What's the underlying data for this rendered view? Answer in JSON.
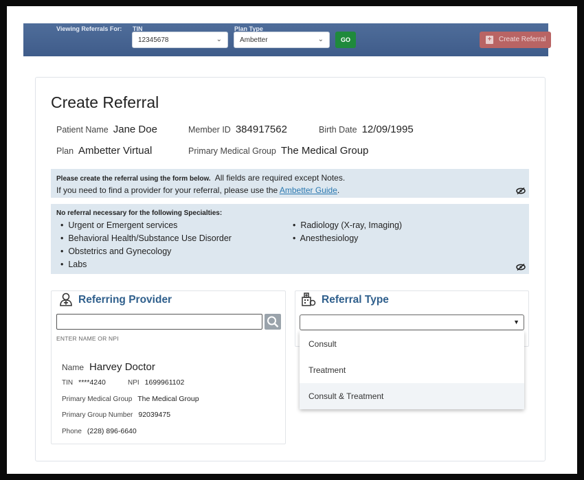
{
  "topbar": {
    "viewing_label": "Viewing Referrals For:",
    "tin_label": "TIN",
    "tin_value": "12345678",
    "plan_type_label": "Plan Type",
    "plan_type_value": "Ambetter",
    "go_label": "GO",
    "create_label": "Create Referral"
  },
  "page": {
    "title": "Create Referral"
  },
  "patient": {
    "name_label": "Patient Name",
    "name_value": "Jane Doe",
    "member_label": "Member ID",
    "member_value": "384917562",
    "birth_label": "Birth Date",
    "birth_value": "12/09/1995",
    "plan_label": "Plan",
    "plan_value": "Ambetter Virtual",
    "pmg_label": "Primary Medical Group",
    "pmg_value": "The Medical Group"
  },
  "info1": {
    "line1_bold": "Please create the referral using the form below.",
    "line1_rest": "All fields are required except Notes.",
    "line2_pre": "If you need to find a provider for your referral, please use the",
    "link": "Ambetter Guide",
    "line2_post": "."
  },
  "info2": {
    "heading": "No referral necessary for the following Specialties:",
    "left": [
      "Urgent or Emergent services",
      "Behavioral Health/Substance Use Disorder",
      "Obstetrics and Gynecology",
      "Labs"
    ],
    "right": [
      "Radiology (X-ray, Imaging)",
      "Anesthesiology"
    ]
  },
  "referring": {
    "title": "Referring Provider",
    "search_value": "",
    "hint": "ENTER NAME OR NPI",
    "name_label": "Name",
    "name_value": "Harvey Doctor",
    "tin_label": "TIN",
    "tin_value": "****4240",
    "npi_label": "NPI",
    "npi_value": "1699961102",
    "pmg_label": "Primary Medical Group",
    "pmg_value": "The Medical Group",
    "pgn_label": "Primary Group Number",
    "pgn_value": "92039475",
    "phone_label": "Phone",
    "phone_value": "(228) 896-6640"
  },
  "referral_type": {
    "title": "Referral Type",
    "selected": "",
    "options": [
      "Consult",
      "Treatment",
      "Consult & Treatment"
    ]
  },
  "colors": {
    "topbar": "#4a6894",
    "go": "#1f8a3c",
    "create": "#b96464",
    "info_bg": "#dde7ef",
    "panel_title": "#2f5f8c"
  }
}
